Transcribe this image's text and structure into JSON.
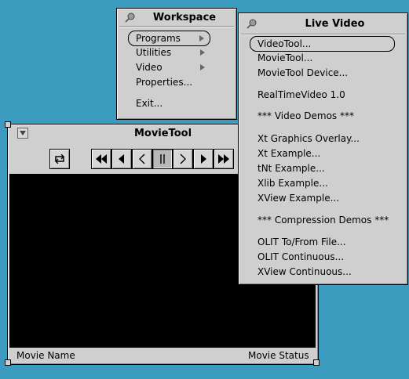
{
  "workspace_menu": {
    "title": "Workspace",
    "items": [
      {
        "label": "Programs",
        "submenu": true,
        "default": true
      },
      {
        "label": "Utilities",
        "submenu": true
      },
      {
        "label": "Video",
        "submenu": true
      },
      {
        "label": "Properties..."
      },
      {
        "label": "Exit..."
      }
    ]
  },
  "live_video_menu": {
    "title": "Live Video",
    "items": [
      {
        "label": "VideoTool..."
      },
      {
        "label": "MovieTool..."
      },
      {
        "label": "MovieTool Device..."
      },
      {
        "label": "RealTimeVideo 1.0"
      },
      {
        "label": "*** Video Demos ***"
      },
      {
        "label": "Xt Graphics Overlay..."
      },
      {
        "label": "Xt Example..."
      },
      {
        "label": "tNt Example..."
      },
      {
        "label": "Xlib Example..."
      },
      {
        "label": "XView Example..."
      },
      {
        "label": "*** Compression Demos ***"
      },
      {
        "label": "OLIT To/From File..."
      },
      {
        "label": "OLIT Continuous..."
      },
      {
        "label": "XView Continuous..."
      }
    ]
  },
  "movietool": {
    "title": "MovieTool",
    "controls": [
      {
        "icon": "loop-icon"
      },
      {
        "icon": "rewind-start-icon"
      },
      {
        "icon": "step-back-icon"
      },
      {
        "icon": "play-reverse-icon"
      },
      {
        "icon": "pause-icon",
        "pressed": true
      },
      {
        "icon": "play-forward-icon"
      },
      {
        "icon": "step-forward-icon"
      },
      {
        "icon": "fast-forward-end-icon"
      }
    ],
    "movie_name_label": "Movie Name",
    "movie_status_label": "Movie Status"
  }
}
